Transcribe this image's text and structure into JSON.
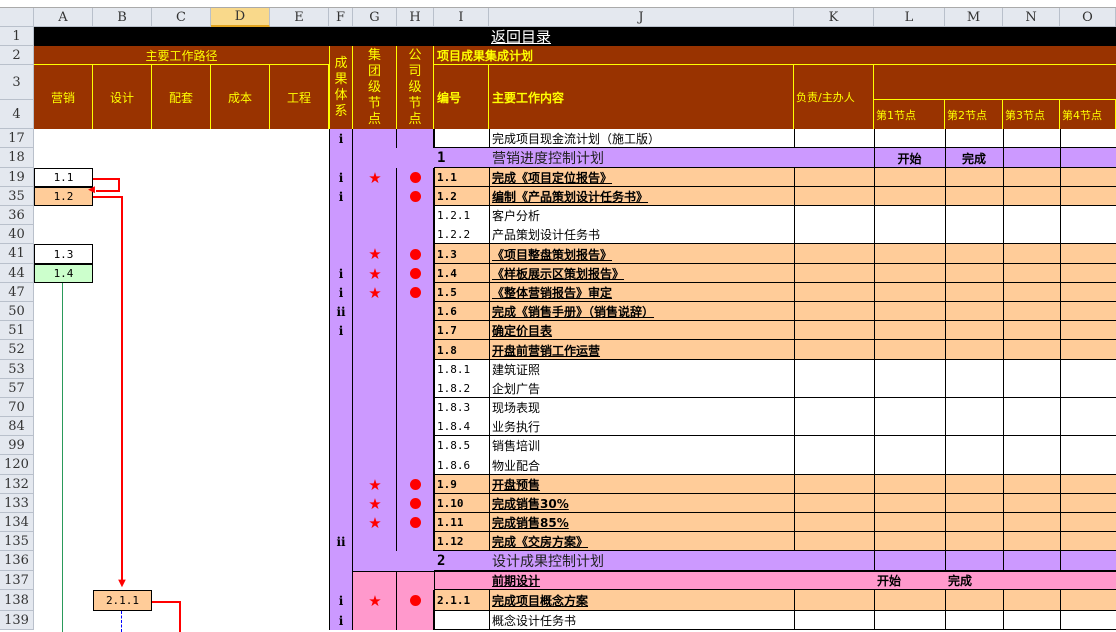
{
  "columns": [
    "A",
    "B",
    "C",
    "D",
    "E",
    "F",
    "G",
    "H",
    "I",
    "J",
    "K",
    "L",
    "M",
    "N",
    "O"
  ],
  "selected_column": "D",
  "header": {
    "back_link": "返回目录",
    "path_title": "主要工作路径",
    "path_cols": [
      "营销",
      "设计",
      "配套",
      "成本",
      "工程"
    ],
    "result_system": "成果体系",
    "group_node": "集团级节点",
    "company_node": "公司级节点",
    "plan_title": "项目成果集成计划",
    "code": "编号",
    "content": "主要工作内容",
    "owner": "负责/主办人",
    "nodes": [
      "第1节点",
      "第2节点",
      "第3节点",
      "第4节点"
    ]
  },
  "header_row_numbers": [
    "1",
    "2",
    "3",
    "4"
  ],
  "rows": [
    {
      "n": "17",
      "type": "plain",
      "f": "i",
      "j": "完成项目现金流计划（施工版）"
    },
    {
      "n": "18",
      "type": "section",
      "i": "1",
      "j": "营销进度控制计划",
      "l": "开始",
      "m": "完成"
    },
    {
      "n": "19",
      "type": "item",
      "f": "i",
      "star": true,
      "dot": true,
      "i": "1.1",
      "j": "完成《项目定位报告》"
    },
    {
      "n": "35",
      "type": "item",
      "f": "i",
      "dot": true,
      "i": "1.2",
      "j": "编制《产品策划设计任务书》"
    },
    {
      "n": "36",
      "type": "sub",
      "i": "1.2.1",
      "j": "客户分析"
    },
    {
      "n": "40",
      "type": "sub",
      "i": "1.2.2",
      "j": "产品策划设计任务书"
    },
    {
      "n": "41",
      "type": "item",
      "star": true,
      "dot": true,
      "i": "1.3",
      "j": "《项目整盘策划报告》"
    },
    {
      "n": "44",
      "type": "item",
      "f": "i",
      "star": true,
      "dot": true,
      "i": "1.4",
      "j": "《样板展示区策划报告》"
    },
    {
      "n": "47",
      "type": "item",
      "f": "i",
      "star": true,
      "dot": true,
      "i": "1.5",
      "j": "《整体营销报告》审定"
    },
    {
      "n": "50",
      "type": "item",
      "f": "ii",
      "i": "1.6",
      "j": "完成《销售手册》（销售说辞）"
    },
    {
      "n": "51",
      "type": "item",
      "f": "i",
      "i": "1.7",
      "j": "确定价目表"
    },
    {
      "n": "52",
      "type": "item",
      "i": "1.8",
      "j": "开盘前营销工作运营"
    },
    {
      "n": "53",
      "type": "sub",
      "i": "1.8.1",
      "j": "建筑证照"
    },
    {
      "n": "57",
      "type": "sub",
      "i": "1.8.2",
      "j": "企划广告"
    },
    {
      "n": "70",
      "type": "sub",
      "i": "1.8.3",
      "j": "现场表现"
    },
    {
      "n": "84",
      "type": "sub",
      "i": "1.8.4",
      "j": "业务执行"
    },
    {
      "n": "99",
      "type": "sub",
      "i": "1.8.5",
      "j": "销售培训"
    },
    {
      "n": "120",
      "type": "sub",
      "i": "1.8.6",
      "j": "物业配合"
    },
    {
      "n": "132",
      "type": "item",
      "star": true,
      "dot": true,
      "i": "1.9",
      "j": "开盘预售"
    },
    {
      "n": "133",
      "type": "item",
      "star": true,
      "dot": true,
      "i": "1.10",
      "j": "完成销售30%"
    },
    {
      "n": "134",
      "type": "item",
      "star": true,
      "dot": true,
      "i": "1.11",
      "j": "完成销售85%"
    },
    {
      "n": "135",
      "type": "item",
      "f": "ii",
      "i": "1.12",
      "j": "完成《交房方案》"
    },
    {
      "n": "136",
      "type": "section",
      "i": "2",
      "j": "设计成果控制计划"
    },
    {
      "n": "137",
      "type": "phase",
      "j": "前期设计",
      "l": "开始",
      "m": "完成"
    },
    {
      "n": "138",
      "type": "pinkitem",
      "f": "i",
      "star": true,
      "dot": true,
      "i": "2.1.1",
      "j": "完成项目概念方案"
    },
    {
      "n": "139",
      "type": "pinksub",
      "f": "i",
      "j": "概念设计任务书"
    }
  ],
  "flow_boxes": [
    {
      "row": "19",
      "col": "A",
      "label": "1.1",
      "color": "#ffffff"
    },
    {
      "row": "35",
      "col": "A",
      "label": "1.2",
      "color": "#ffcc99"
    },
    {
      "row": "41",
      "col": "A",
      "label": "1.3",
      "color": "#ffffff"
    },
    {
      "row": "44",
      "col": "A",
      "label": "1.4",
      "color": "#ccffcc"
    },
    {
      "row": "138",
      "col": "B",
      "label": "2.1.1",
      "color": "#ffcc99"
    }
  ],
  "colors": {
    "brown": "#993300",
    "yellow": "#ffff00",
    "purple": "#cc99ff",
    "orange": "#ffcc99",
    "pink": "#ff99cc",
    "red": "#ff0000"
  }
}
